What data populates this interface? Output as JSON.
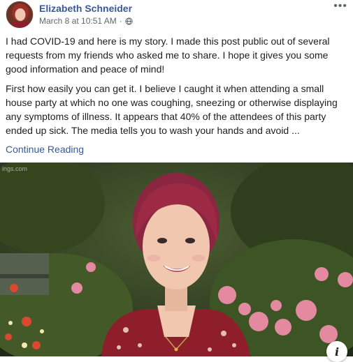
{
  "post": {
    "author": "Elizabeth Schneider",
    "timestamp": "March 8 at 10:51 AM",
    "separator": "·",
    "privacy_icon": "globe-icon",
    "more_icon": "more-options-icon",
    "more_glyph": "•••",
    "paragraphs": [
      "I had COVID-19 and here is my story. I made this post public out of several requests from my friends who asked me to share. I hope it gives you some good information and peace of mind!",
      "First how easily you can get it. I believe I caught it when attending a small house party at which no one was coughing, sneezing or otherwise displaying any symptoms of illness. It appears that 40% of the attendees of this party ended up sick. The media tells you to wash your hands and avoid ..."
    ],
    "continue_label": "Continue Reading"
  },
  "media": {
    "watermark": "ings.com",
    "info_glyph": "i",
    "info_icon": "info-icon"
  },
  "colors": {
    "link": "#385898",
    "meta": "#606770",
    "text": "#1c1e21"
  }
}
